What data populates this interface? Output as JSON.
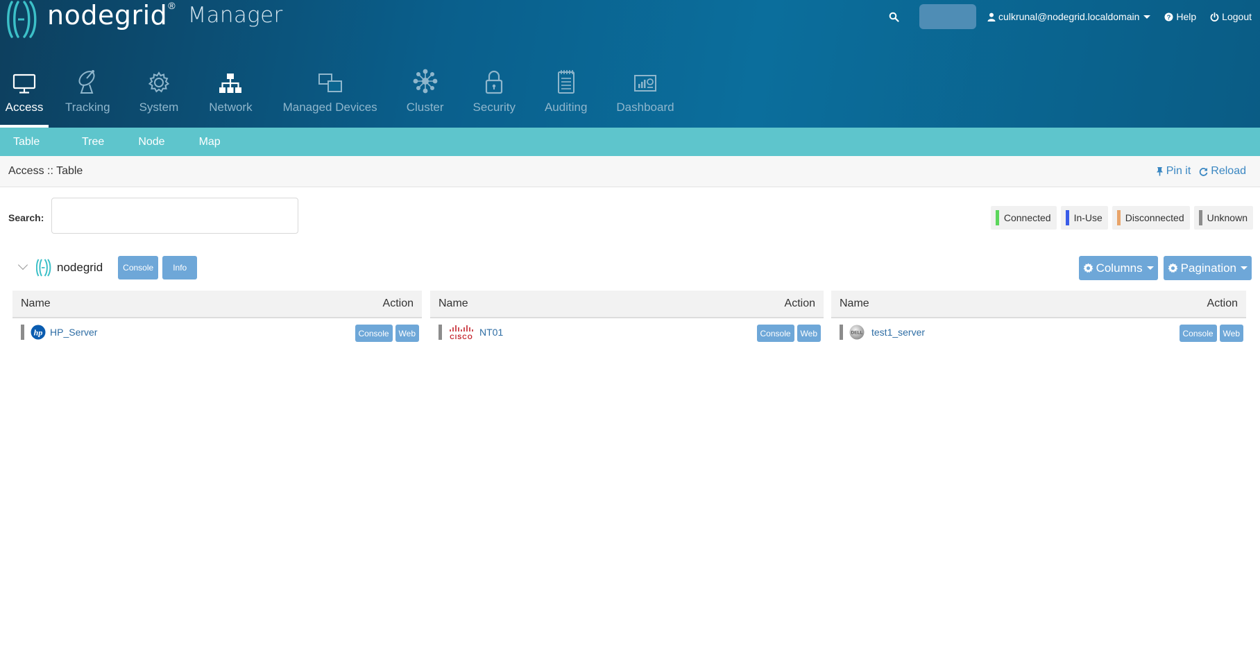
{
  "brand": {
    "name": "nodegrid",
    "reg": "®",
    "product": "Manager"
  },
  "topbar": {
    "user": "culkrunal@nodegrid.localdomain",
    "help": "Help",
    "logout": "Logout"
  },
  "mainnav": [
    {
      "label": "Access",
      "icon": "monitor-icon",
      "state": "active"
    },
    {
      "label": "Tracking",
      "icon": "satellite-dish-icon",
      "state": "muted"
    },
    {
      "label": "System",
      "icon": "gear-icon",
      "state": "muted"
    },
    {
      "label": "Network",
      "icon": "network-icon",
      "state": "bright"
    },
    {
      "label": "Managed Devices",
      "icon": "devices-icon",
      "state": "muted"
    },
    {
      "label": "Cluster",
      "icon": "cluster-icon",
      "state": "muted"
    },
    {
      "label": "Security",
      "icon": "lock-icon",
      "state": "muted"
    },
    {
      "label": "Auditing",
      "icon": "notepad-icon",
      "state": "muted"
    },
    {
      "label": "Dashboard",
      "icon": "dashboard-icon",
      "state": "muted"
    }
  ],
  "subnav": [
    "Table",
    "Tree",
    "Node",
    "Map"
  ],
  "breadcrumb": "Access :: Table",
  "crumb_actions": {
    "pin": "Pin it",
    "reload": "Reload"
  },
  "search": {
    "label": "Search:",
    "value": ""
  },
  "legend": [
    {
      "label": "Connected",
      "color": "#5cd65c"
    },
    {
      "label": "In-Use",
      "color": "#3a5ce8"
    },
    {
      "label": "Disconnected",
      "color": "#e8a46a"
    },
    {
      "label": "Unknown",
      "color": "#8c8c8c"
    }
  ],
  "node": {
    "name": "nodegrid",
    "console": "Console",
    "info": "Info",
    "columns": "Columns",
    "pagination": "Pagination"
  },
  "tables": [
    {
      "col_name": "Name",
      "col_action": "Action",
      "device": "HP_Server",
      "logo": "hp-logo-icon",
      "console": "Console",
      "web": "Web"
    },
    {
      "col_name": "Name",
      "col_action": "Action",
      "device": "NT01",
      "logo": "cisco-logo-icon",
      "logo_text": "CISCO",
      "console": "Console",
      "web": "Web"
    },
    {
      "col_name": "Name",
      "col_action": "Action",
      "device": "test1_server",
      "logo": "dell-logo-icon",
      "logo_text": "DELL",
      "console": "Console",
      "web": "Web"
    }
  ],
  "colors": {
    "header_dark": "#0d3f5e",
    "header_light": "#0b6e9c",
    "subnav": "#5ec5cc",
    "button": "#6ea7d8",
    "link": "#2e6da4",
    "teal": "#3cc0c8"
  }
}
